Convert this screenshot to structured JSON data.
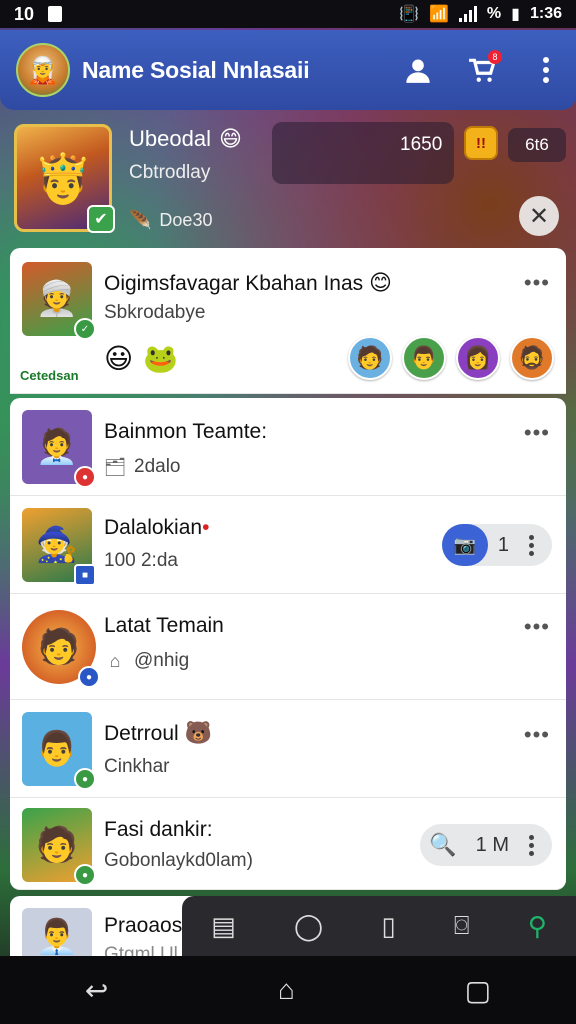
{
  "status_bar": {
    "left_text": "10",
    "battery_pct": "%",
    "time": "1:36"
  },
  "header": {
    "title": "Name Sosial Nnlasaii",
    "cart_badge": "8",
    "icons": [
      "user-icon",
      "cart-icon",
      "kebab-menu-icon"
    ]
  },
  "profile": {
    "name": "Ubeodal",
    "subtitle": "Cbtrodlay",
    "tag": "Doe30",
    "stat": "1650",
    "coin_label": "!!",
    "stat2": "6t6"
  },
  "items": [
    {
      "title": "Oigimsfavagar Kbahan Inas",
      "subtitle": "Sbkrodabye",
      "caption": "Cetedsan"
    },
    {
      "title": "Bainmon Teamte:",
      "subtitle": "2dalo"
    },
    {
      "title": "Dalalokian",
      "subtitle": "100 2:da",
      "count": "1"
    },
    {
      "title": "Latat Temain",
      "subtitle": "@nhig"
    },
    {
      "title": "Detrroul",
      "subtitle": "Cinkhar"
    },
    {
      "title": "Fasi dankir:",
      "subtitle": "Gobonlaykd0lam)",
      "count": "1 M"
    },
    {
      "title": "Praoaos",
      "subtitle": "Gtgml Ul"
    }
  ],
  "colors": {
    "header_blue": "#2f4aa3",
    "accent_blue": "#3c63d6",
    "active_tab": "#1fb36a"
  }
}
